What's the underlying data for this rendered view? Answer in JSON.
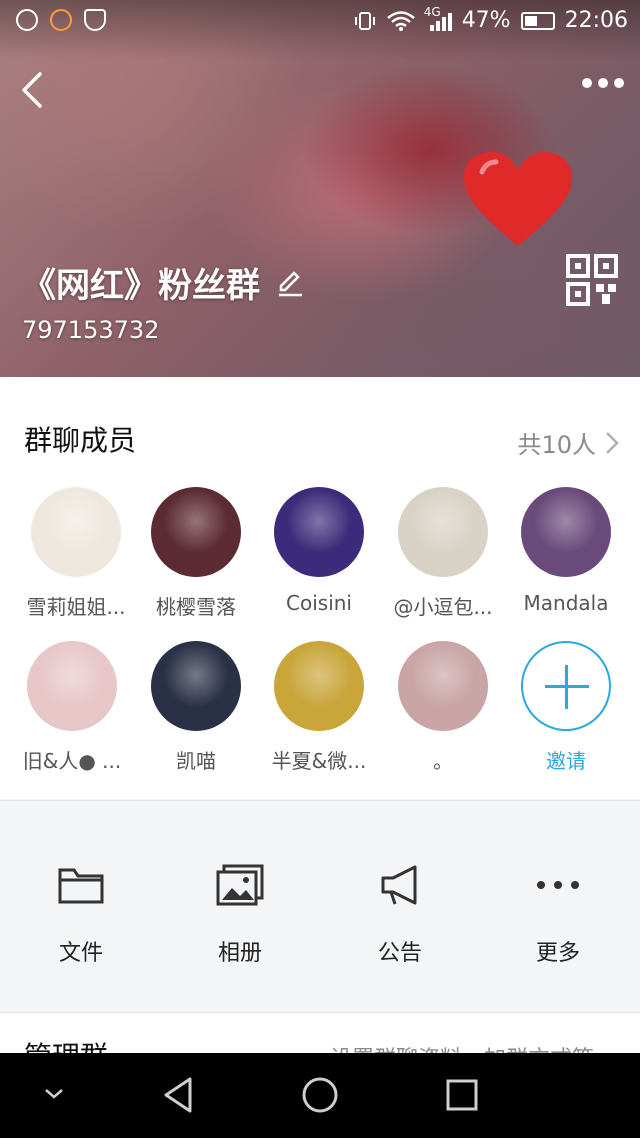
{
  "status_bar": {
    "network": "4G",
    "battery": "47%",
    "battery_level": 0.47,
    "time": "22:06"
  },
  "header": {
    "group_name": "《网红》粉丝群",
    "group_id": "797153732"
  },
  "members": {
    "title": "群聊成员",
    "count": "共10人",
    "items": [
      {
        "name": "雪莉姐姐...",
        "color": "#efe8df"
      },
      {
        "name": "桃樱雪落",
        "color": "#5b2a32"
      },
      {
        "name": "Coisini",
        "color": "#3c2a7a"
      },
      {
        "name": "@小逗包...",
        "color": "#d9d2c6"
      },
      {
        "name": "Mandala",
        "color": "#6a4a7a"
      },
      {
        "name": "旧&人● ...",
        "color": "#e8c7c9"
      },
      {
        "name": "凯喵",
        "color": "#2a3046"
      },
      {
        "name": "半夏&微...",
        "color": "#c9a53a"
      },
      {
        "name": "。",
        "color": "#c9a5a6"
      }
    ],
    "invite_label": "邀请"
  },
  "actions": [
    {
      "label": "文件",
      "icon": "folder-icon"
    },
    {
      "label": "相册",
      "icon": "album-icon"
    },
    {
      "label": "公告",
      "icon": "megaphone-icon"
    },
    {
      "label": "更多",
      "icon": "more-dots-icon"
    }
  ],
  "manage": {
    "title": "管理群",
    "subtitle": "设置群聊资料、加群方式等"
  },
  "colors": {
    "accent": "#2aa8e0",
    "heart": "#e02a2a"
  }
}
